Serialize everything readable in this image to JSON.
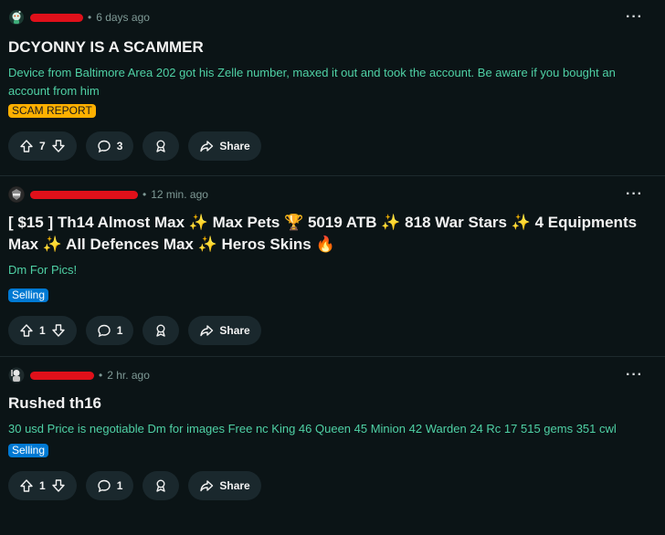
{
  "posts": [
    {
      "time": "6 days ago",
      "title": "DCYONNY IS A SCAMMER",
      "body": "Device from Baltimore Area 202 got his Zelle number, maxed it out and took the account. Be aware if you bought an account from him",
      "flair": "SCAM REPORT",
      "votes": "7",
      "comments": "3",
      "share_label": "Share"
    },
    {
      "time": "12 min. ago",
      "title_line1": "[ $15 ] Th14 Almost Max ✨ Max Pets 🏆 5019 ATB ✨ 818 War Stars ✨ 4 Equipments",
      "title_line2": "Max ✨ All Defences Max ✨ Heros Skins 🔥",
      "body": "Dm For Pics!",
      "flair": "Selling",
      "votes": "1",
      "comments": "1",
      "share_label": "Share"
    },
    {
      "time": "2 hr. ago",
      "title": "Rushed th16",
      "body": "30 usd Price is negotiable Dm for images Free nc King 46 Queen 45 Minion 42 Warden 24 Rc 17 515 gems 351 cwl",
      "flair": "Selling",
      "votes": "1",
      "comments": "1",
      "share_label": "Share"
    }
  ],
  "colors": {
    "background": "#0b1416",
    "body_text": "#4fd1a5",
    "scam_flair": "#ffb000",
    "selling_flair": "#0079d3",
    "redaction": "#e0101a",
    "pill": "#1a282d"
  }
}
